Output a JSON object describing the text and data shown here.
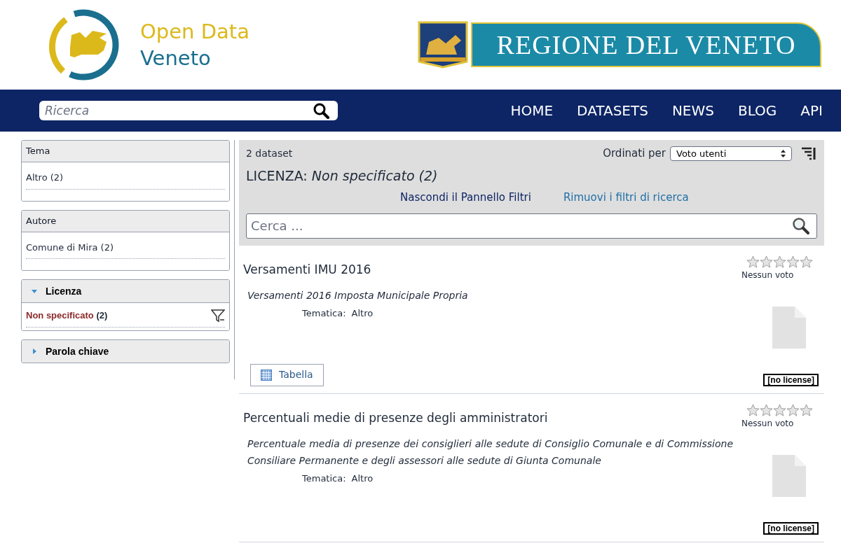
{
  "brand": {
    "line1": "Open Data",
    "line2": "Veneto"
  },
  "region_logo": {
    "text": "REGIONE DEL VENETO"
  },
  "nav": {
    "search_placeholder": "Ricerca",
    "links": [
      {
        "label": "HOME"
      },
      {
        "label": "DATASETS"
      },
      {
        "label": "NEWS"
      },
      {
        "label": "BLOG"
      },
      {
        "label": "API"
      }
    ]
  },
  "facets": [
    {
      "title": "Tema",
      "kind": "plain",
      "items": [
        {
          "label": "Altro",
          "count": "(2)",
          "selected": false
        }
      ]
    },
    {
      "title": "Autore",
      "kind": "plain",
      "items": [
        {
          "label": "Comune di Mira",
          "count": "(2)",
          "selected": false
        }
      ]
    },
    {
      "title": "Licenza",
      "kind": "toggle",
      "expanded": true,
      "items": [
        {
          "label": "Non specificato",
          "count": "(2)",
          "selected": true
        }
      ]
    },
    {
      "title": "Parola chiave",
      "kind": "toggle",
      "expanded": false
    }
  ],
  "results": {
    "count": "2 dataset",
    "sort_label": "Ordinati per",
    "sort_value": "Voto utenti",
    "filter_key": "LICENZA:",
    "filter_value": "Non specificato (2)",
    "hide_link": "Nascondi il Pannello Filtri",
    "remove_link": "Rimuovi i filtri di ricerca",
    "search_placeholder": "Cerca ..."
  },
  "datasets": [
    {
      "title": "Versamenti IMU 2016",
      "stars": 0,
      "rating_text": "Nessun voto",
      "description": "Versamenti 2016 Imposta Municipale Propria",
      "theme_label": "Tematica:",
      "theme": "Altro",
      "resources": [
        {
          "label": "Tabella"
        }
      ],
      "license": "[no license]"
    },
    {
      "title": "Percentuali medie di presenze degli amministratori",
      "stars": 0,
      "rating_text": "Nessun voto",
      "description": "Percentuale media di presenze dei consiglieri alle sedute di Consiglio Comunale e di Commissione Consiliare Permanente e degli assessori alle sedute di Giunta Comunale",
      "theme_label": "Tematica:",
      "theme": "Altro",
      "license": "[no license]"
    }
  ]
}
